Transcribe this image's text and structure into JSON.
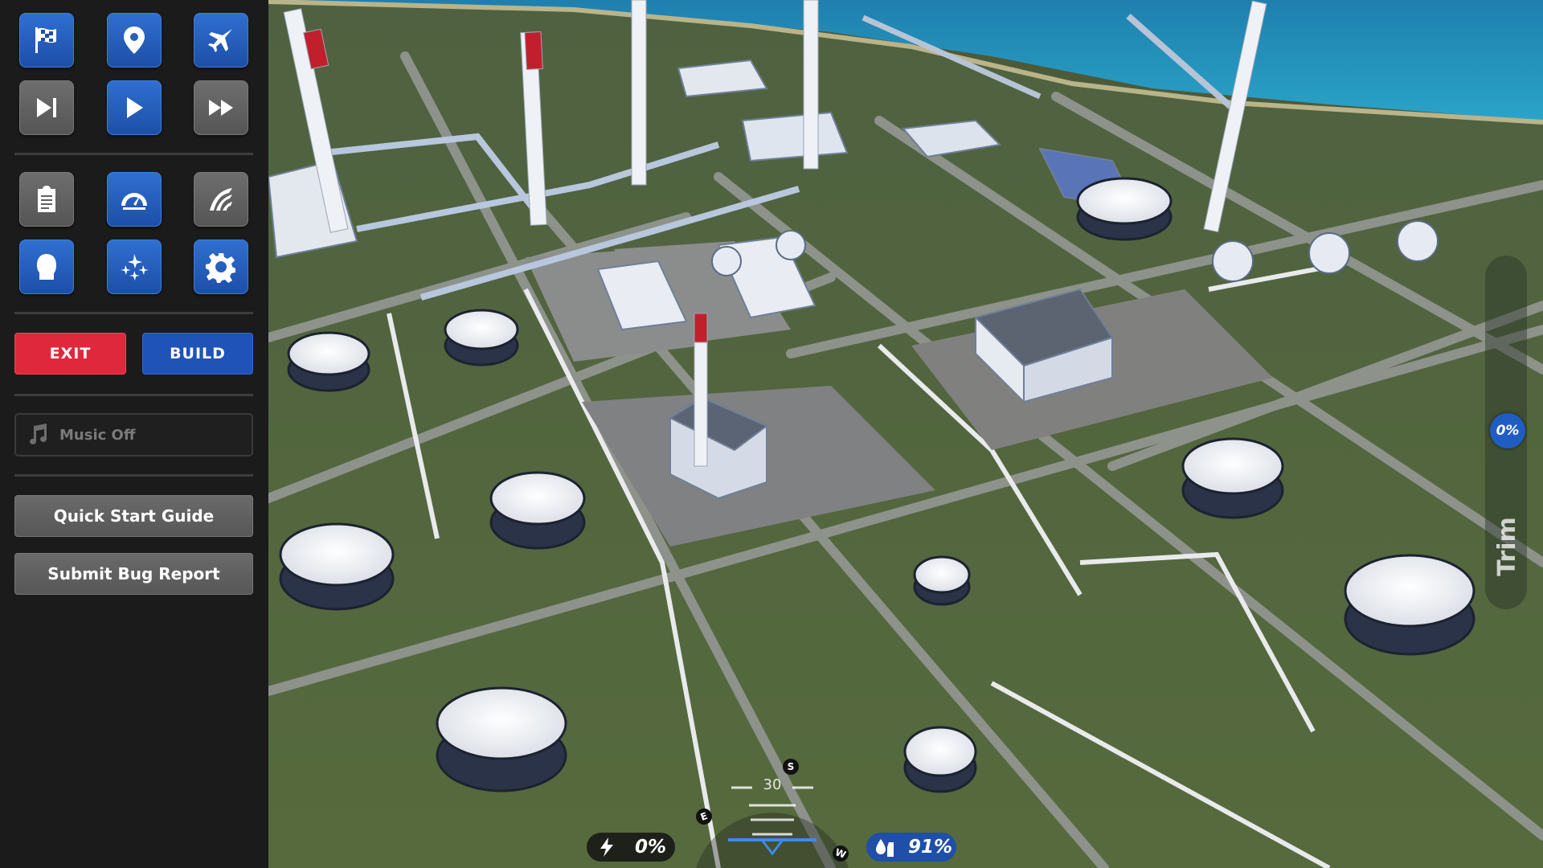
{
  "panel": {
    "icon_rows": [
      [
        {
          "icon": "checkered-flag-icon",
          "style": "blue"
        },
        {
          "icon": "map-pin-icon",
          "style": "blue"
        },
        {
          "icon": "jet-plane-icon",
          "style": "blue"
        }
      ],
      [
        {
          "icon": "skip-forward-icon",
          "style": "grey"
        },
        {
          "icon": "play-icon",
          "style": "blue"
        },
        {
          "icon": "fast-forward-icon",
          "style": "grey"
        }
      ],
      [
        {
          "icon": "clipboard-icon",
          "style": "grey"
        },
        {
          "icon": "speedometer-icon",
          "style": "blue"
        },
        {
          "icon": "flight-path-icon",
          "style": "grey"
        }
      ],
      [
        {
          "icon": "pilot-head-icon",
          "style": "blue"
        },
        {
          "icon": "jets-formation-icon",
          "style": "blue"
        },
        {
          "icon": "settings-gear-icon",
          "style": "blue"
        }
      ]
    ],
    "exit_label": "EXIT",
    "build_label": "BUILD",
    "music_label": "Music Off",
    "quick_start_label": "Quick Start Guide",
    "bug_report_label": "Submit Bug Report"
  },
  "hud": {
    "trim_label": "Trim",
    "trim_value": "0%",
    "power_value": "0%",
    "fuel_value": "91%",
    "compass": {
      "pitch_value": "30",
      "heading_letters": [
        "S",
        "E",
        "W"
      ]
    }
  },
  "colors": {
    "accent_blue": "#1f53b8",
    "exit_red": "#e0283d",
    "panel_bg": "#1b1b1b",
    "grass": "#55663f",
    "road": "#8a8f88",
    "sea": "#1f8fb8"
  }
}
